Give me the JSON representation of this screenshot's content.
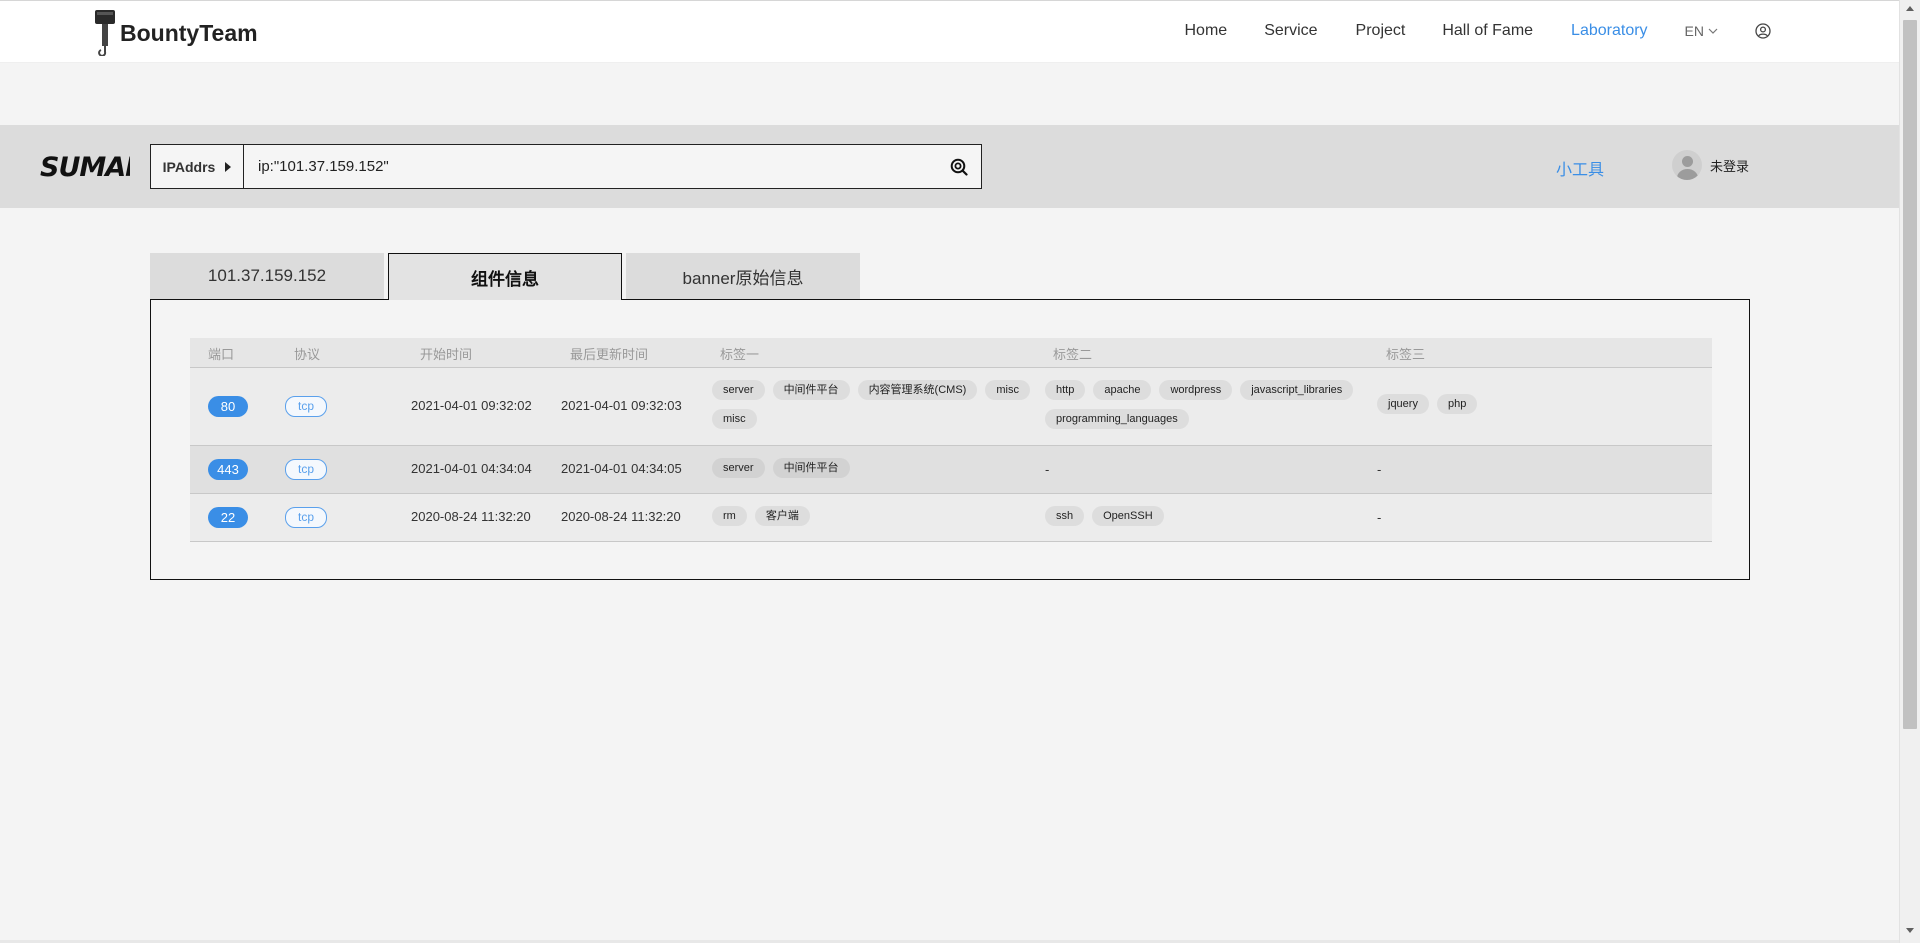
{
  "nav": {
    "brand": "BountyTeam",
    "links": [
      "Home",
      "Service",
      "Project",
      "Hall of Fame",
      "Laboratory"
    ],
    "active_link": "Laboratory",
    "lang": "EN"
  },
  "search": {
    "field": "IPAddrs",
    "query": "ip:\"101.37.159.152\"",
    "tools_link": "小工具",
    "user_label": "未登录"
  },
  "tabs": [
    {
      "label": "101.37.159.152",
      "active": false
    },
    {
      "label": "组件信息",
      "active": true
    },
    {
      "label": "banner原始信息",
      "active": false
    }
  ],
  "table": {
    "headers": [
      "端口",
      "协议",
      "开始时间",
      "最后更新时间",
      "标签一",
      "标签二",
      "标签三"
    ],
    "rows": [
      {
        "port": "80",
        "protocol": "tcp",
        "start": "2021-04-01 09:32:02",
        "updated": "2021-04-01 09:32:03",
        "tags1": [
          "server",
          "中间件平台",
          "内容管理系统(CMS)",
          "misc",
          "misc"
        ],
        "tags2": [
          "http",
          "apache",
          "wordpress",
          "javascript_libraries",
          "programming_languages"
        ],
        "tags3": [
          "jquery",
          "php"
        ]
      },
      {
        "port": "443",
        "protocol": "tcp",
        "start": "2021-04-01 04:34:04",
        "updated": "2021-04-01 04:34:05",
        "tags1": [
          "server",
          "中间件平台"
        ],
        "tags2": [],
        "tags3": []
      },
      {
        "port": "22",
        "protocol": "tcp",
        "start": "2020-08-24 11:32:20",
        "updated": "2020-08-24 11:32:20",
        "tags1": [
          "rm",
          "客户端"
        ],
        "tags2": [
          "ssh",
          "OpenSSH"
        ],
        "tags3": []
      }
    ],
    "empty_placeholder": "-"
  },
  "colors": {
    "accent": "#3a8ee6",
    "band": "#dcdcdc",
    "background": "#f4f4f4"
  }
}
